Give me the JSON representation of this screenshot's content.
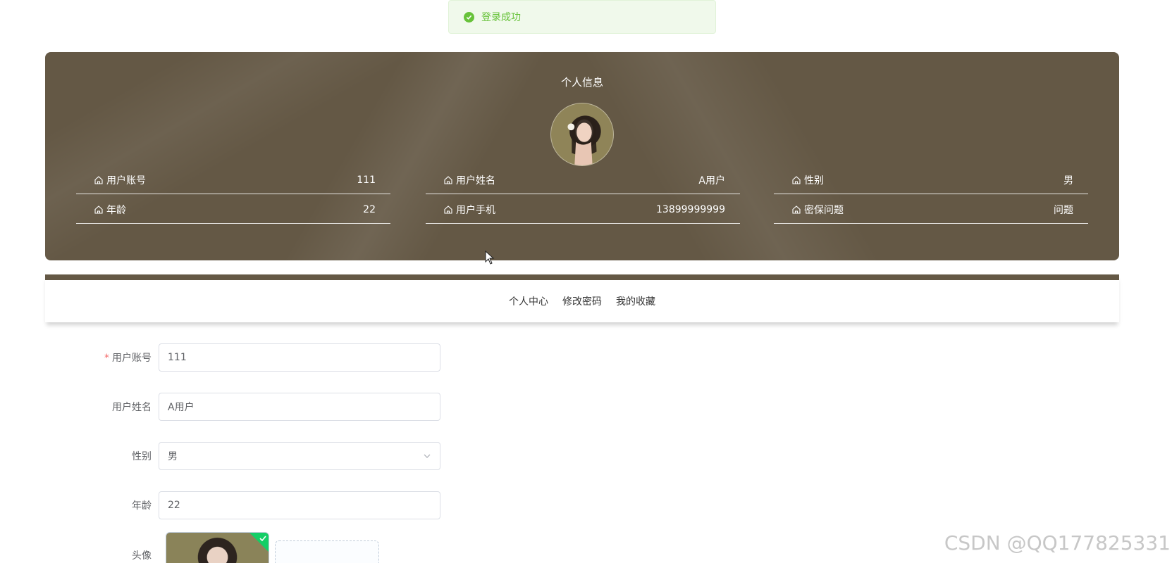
{
  "toast": {
    "message": "登录成功",
    "color": "#67c23a"
  },
  "profile": {
    "title": "个人信息",
    "background": "#645845",
    "rows": [
      {
        "label": "用户账号",
        "value": "111"
      },
      {
        "label": "用户姓名",
        "value": "A用户"
      },
      {
        "label": "性别",
        "value": "男"
      },
      {
        "label": "年龄",
        "value": "22"
      },
      {
        "label": "用户手机",
        "value": "13899999999"
      },
      {
        "label": "密保问题",
        "value": "问题"
      }
    ]
  },
  "tabs": [
    {
      "label": "个人中心"
    },
    {
      "label": "修改密码"
    },
    {
      "label": "我的收藏"
    }
  ],
  "form": {
    "account": {
      "label": "用户账号",
      "required_mark": "*",
      "value": "111"
    },
    "name": {
      "label": "用户姓名",
      "value": "A用户"
    },
    "gender": {
      "label": "性别",
      "value": "男"
    },
    "age": {
      "label": "年龄",
      "value": "22"
    },
    "avatar": {
      "label": "头像"
    }
  },
  "watermark": "CSDN @QQ177825331"
}
